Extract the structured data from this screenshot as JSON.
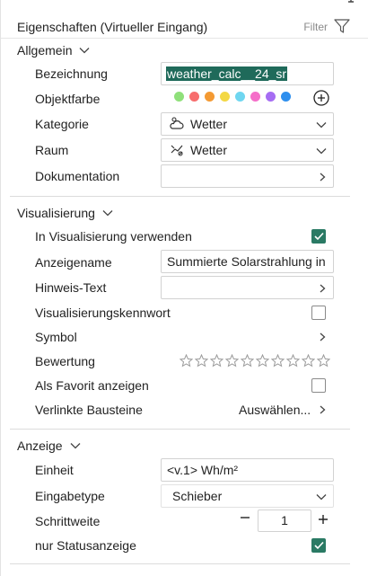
{
  "header": {
    "title": "Eigenschaften (Virtueller Eingang)",
    "filter_label": "Filter",
    "icons": {
      "filter": "filter-funnel-icon",
      "pin": "pin-icon"
    }
  },
  "allgemein": {
    "section_label": "Allgemein",
    "bezeichnung": {
      "label": "Bezeichnung",
      "value": "weather_calc__24_sr"
    },
    "objektfarbe": {
      "label": "Objektfarbe",
      "colors": [
        "#8fe07a",
        "#f76d6d",
        "#f49a33",
        "#f3d844",
        "#6fd6f0",
        "#f56fc9",
        "#a66df3",
        "#2e8fee"
      ],
      "add_icon": "plus-circle-icon"
    },
    "kategorie": {
      "label": "Kategorie",
      "value": "Wetter",
      "icon": "weather-cloud-icon"
    },
    "raum": {
      "label": "Raum",
      "value": "Wetter",
      "icon": "room-weather-icon"
    },
    "dokumentation": {
      "label": "Dokumentation",
      "value": ""
    }
  },
  "visualisierung": {
    "section_label": "Visualisierung",
    "in_visu": {
      "label": "In Visualisierung verwenden",
      "checked": true
    },
    "anzeigename": {
      "label": "Anzeigename",
      "value": "Summierte Solarstrahlung in d"
    },
    "hinweis": {
      "label": "Hinweis-Text",
      "value": ""
    },
    "kennwort": {
      "label": "Visualisierungskennwort",
      "checked": false
    },
    "symbol": {
      "label": "Symbol"
    },
    "bewertung": {
      "label": "Bewertung",
      "stars": 10,
      "rating": 0
    },
    "favorit": {
      "label": "Als Favorit anzeigen",
      "checked": false
    },
    "bausteine": {
      "label": "Verlinkte Bausteine",
      "value": "Auswählen..."
    }
  },
  "anzeige": {
    "section_label": "Anzeige",
    "einheit": {
      "label": "Einheit",
      "value": "<v.1> Wh/m²"
    },
    "eingabetype": {
      "label": "Eingabetype",
      "value": "Schieber"
    },
    "schrittweite": {
      "label": "Schrittweite",
      "value": "1"
    },
    "status": {
      "label": "nur Statusanzeige",
      "checked": true
    }
  },
  "colors": {
    "accent": "#2a7a64",
    "selection": "#1f6a5a"
  }
}
